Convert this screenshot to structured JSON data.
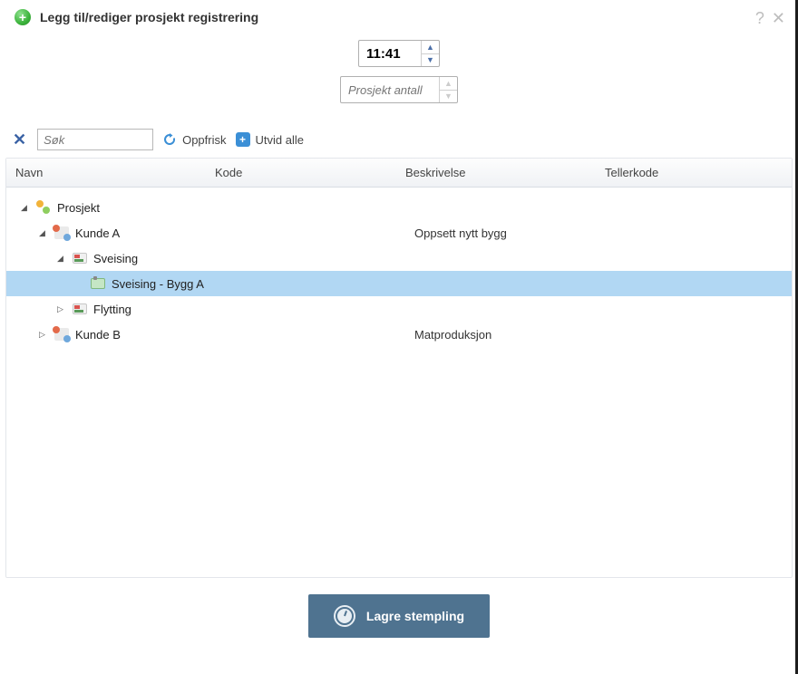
{
  "dialog": {
    "title": "Legg til/rediger prosjekt registrering"
  },
  "time": {
    "value": "11:41"
  },
  "amount": {
    "placeholder": "Prosjekt antall"
  },
  "toolbar": {
    "search_placeholder": "Søk",
    "refresh_label": "Oppfrisk",
    "expand_label": "Utvid alle"
  },
  "columns": {
    "navn": "Navn",
    "kode": "Kode",
    "beskrivelse": "Beskrivelse",
    "tellerkode": "Tellerkode"
  },
  "tree": {
    "root": "Prosjekt",
    "kunde_a": {
      "label": "Kunde A",
      "beskrivelse": "Oppsett nytt bygg"
    },
    "sveising": {
      "label": "Sveising"
    },
    "sveising_bygg_a": {
      "label": "Sveising - Bygg A"
    },
    "flytting": {
      "label": "Flytting"
    },
    "kunde_b": {
      "label": "Kunde B",
      "beskrivelse": "Matproduksjon"
    }
  },
  "footer": {
    "save_label": "Lagre stempling"
  }
}
